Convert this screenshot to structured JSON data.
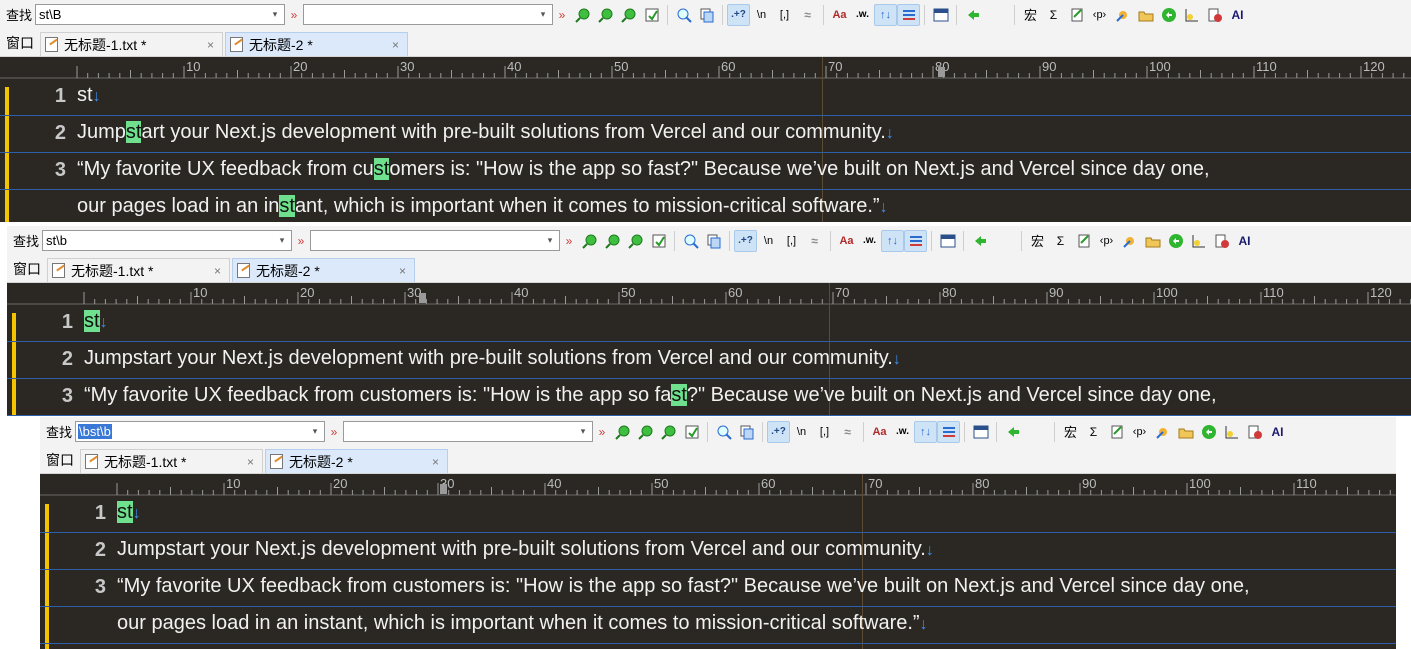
{
  "labels": {
    "find": "查找",
    "window": "窗口",
    "tab1": "无标题-1.txt *",
    "tab2": "无标题-2 *",
    "close": "×",
    "chevron": "»",
    "combo_arrow": "▾",
    "tb_regex": ".+?",
    "tb_newline": "\\n",
    "tb_bracket": "[,]",
    "tb_fuzzy": "≈",
    "tb_case": "Aa",
    "tb_word": ".w.",
    "tb_updown": "↑↓",
    "tb_macro": "宏",
    "tb_sigma": "Σ",
    "tb_tag": "‹p›",
    "tb_ai": "AI"
  },
  "panels": [
    {
      "find_value": "st\\B",
      "find_selected": false,
      "replace_value": ""
    },
    {
      "find_value": "st\\b",
      "find_selected": false,
      "replace_value": ""
    },
    {
      "find_value": "\\bst\\b",
      "find_selected": true,
      "replace_value": ""
    }
  ],
  "ruler_numbers": [
    "10",
    "20",
    "30",
    "40",
    "50",
    "60",
    "70",
    "80",
    "90",
    "100",
    "110",
    "120"
  ],
  "lines": {
    "n1": "1",
    "n2": "2",
    "n3": "3",
    "l1": "st",
    "l2": "Jumpstart your Next.js development with pre-built solutions from Vercel and our community.",
    "l3a": "“My favorite UX feedback from customers is: \"How is the app so fast?\" Because we’ve built on Next.js and Vercel since day one,",
    "l3b": "our pages load in an instant, which is important when it comes to mission-critical software.”",
    "p1_l2_pre": "Jump",
    "p1_l2_hl": "st",
    "p1_l2_post": "art your Next.js development with pre-built solutions from Vercel and our community.",
    "p1_l3a_pre": "“My favorite UX feedback from cu",
    "p1_l3a_hl": "st",
    "p1_l3a_post": "omers is: \"How is the app so fast?\" Because we’ve built on Next.js and Vercel since day one,",
    "p1_l3b_pre": "our pages load in an in",
    "p1_l3b_hl": "st",
    "p1_l3b_post": "ant, which is important when it comes to mission-critical software.”",
    "p2_l3a_pre": "“My favorite UX feedback from customers is: \"How is the app so fa",
    "p2_l3a_hl": "st",
    "p2_l3a_post": "?\" Because we’ve built on Next.js and Vercel since day one,"
  },
  "colors": {
    "editor_bg": "#2b2823",
    "match_highlight": "#6fe08d",
    "line_separator": "#2d5fa8",
    "change_marker": "#f5c400"
  }
}
